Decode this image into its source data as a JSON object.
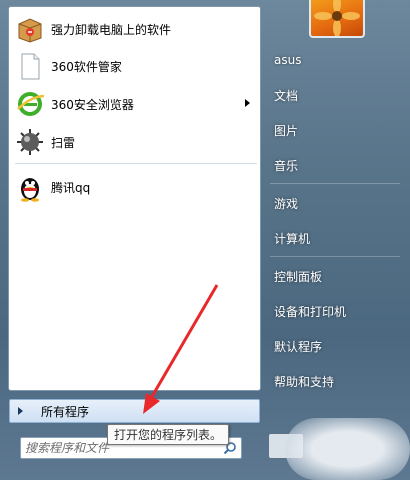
{
  "programs": [
    {
      "label": "强力卸载电脑上的软件",
      "icon": "uninstaller-box-icon",
      "has_submenu": false
    },
    {
      "label": "360软件管家",
      "icon": "blank-document-icon",
      "has_submenu": false
    },
    {
      "label": "360安全浏览器",
      "icon": "360-browser-icon",
      "has_submenu": true
    },
    {
      "label": "扫雷",
      "icon": "minesweeper-mine-icon",
      "has_submenu": false
    },
    {
      "label": "腾讯qq",
      "icon": "qq-penguin-icon",
      "has_submenu": false
    }
  ],
  "all_programs": {
    "label": "所有程序"
  },
  "search": {
    "placeholder": "搜索程序和文件"
  },
  "tooltip": {
    "text": "打开您的程序列表。"
  },
  "right_items": [
    {
      "label": "asus"
    },
    {
      "label": "文档"
    },
    {
      "label": "图片"
    },
    {
      "label": "音乐"
    },
    {
      "label": "游戏"
    },
    {
      "label": "计算机"
    },
    {
      "label": "控制面板"
    },
    {
      "label": "设备和打印机"
    },
    {
      "label": "默认程序"
    },
    {
      "label": "帮助和支持"
    }
  ],
  "colors": {
    "annotation_arrow": "#e8282b",
    "left_pane_bg": "#ffffff",
    "right_pane_bg": "#587489"
  }
}
